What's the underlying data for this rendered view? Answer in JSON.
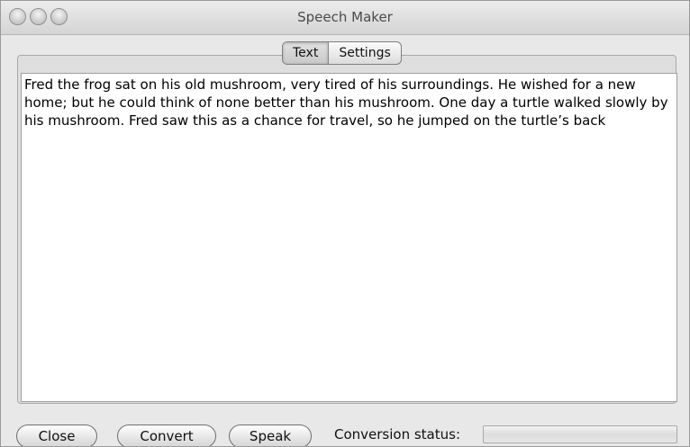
{
  "window": {
    "title": "Speech Maker"
  },
  "tabs": [
    {
      "label": "Text",
      "selected": true
    },
    {
      "label": "Settings",
      "selected": false
    }
  ],
  "text_area": {
    "content": "Fred the frog sat on his old mushroom, very tired of his surroundings. He wished for a new home; but he could think of none better than his mushroom. One day a turtle walked slowly by his mushroom. Fred saw this as a chance for travel, so he jumped on the turtle’s back"
  },
  "buttons": {
    "close": "Close",
    "convert": "Convert",
    "speak": "Speak"
  },
  "status": {
    "label": "Conversion status:",
    "progress": 0
  }
}
